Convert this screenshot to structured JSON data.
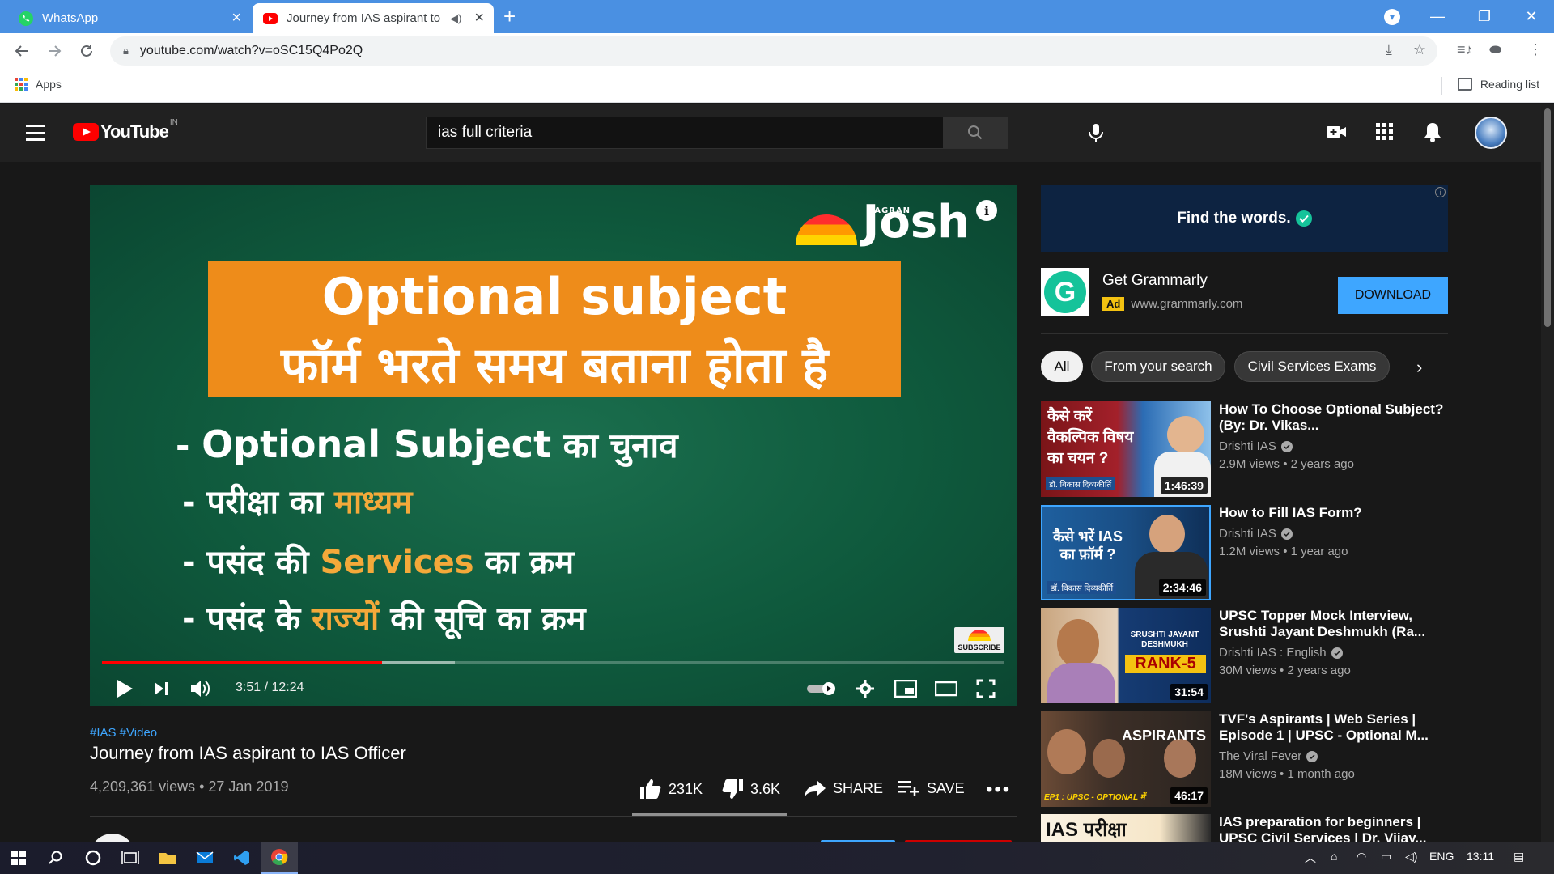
{
  "browser": {
    "tabs": [
      {
        "label": "WhatsApp",
        "icon": "whatsapp-icon",
        "active": false
      },
      {
        "label": "Journey from IAS aspirant to",
        "icon": "youtube-icon",
        "active": true
      }
    ],
    "url": "youtube.com/watch?v=oSC15Q4Po2Q",
    "bookmarks": {
      "apps_label": "Apps",
      "reading_list_label": "Reading list"
    }
  },
  "yt": {
    "logo_text": "YouTube",
    "region": "IN",
    "search_query": "ias full criteria"
  },
  "player": {
    "brand_small": "JAGRAN",
    "brand": "Josh",
    "banner_line1": "Optional subject",
    "banner_line2": "फॉर्म भरते समय बताना होता है",
    "bullets": [
      {
        "prefix": "- ",
        "highlight_white": "Optional Subject",
        "rest": " का चुनाव"
      },
      {
        "prefix": "- परीक्षा का ",
        "highlight": "माध्यम",
        "rest": ""
      },
      {
        "prefix": "- पसंद की ",
        "highlight": "Services",
        "rest": " का क्रम"
      },
      {
        "prefix": "- पसंद के ",
        "highlight": "राज्यों",
        "rest": " की सूचि का क्रम"
      }
    ],
    "subscribe_badge": "SUBSCRIBE",
    "time_text": "3:51 / 12:24",
    "progress_fraction": 0.3104,
    "buffer_fraction": 0.31
  },
  "video": {
    "tags": "#IAS #Video",
    "title": "Journey from IAS aspirant to IAS Officer",
    "views_date": "4,209,361 views • 27 Jan 2019",
    "likes": "231K",
    "dislikes": "3.6K",
    "share_label": "SHARE",
    "save_label": "SAVE"
  },
  "ad": {
    "banner_text": "Find the words.",
    "title": "Get Grammarly",
    "badge": "Ad",
    "domain": "www.grammarly.com",
    "cta": "DOWNLOAD"
  },
  "chips": [
    "All",
    "From your search",
    "Civil Services Exams"
  ],
  "recommendations": [
    {
      "title": "How To Choose Optional Subject? (By: Dr. Vikas...",
      "channel": "Drishti IAS",
      "verified": true,
      "meta": "2.9M views • 2 years ago",
      "duration": "1:46:39",
      "thumb_text": "कैसे करें वैकल्पिक विषय का चयन ?",
      "thumb_caption": "डॉ. विकास दिव्यकीर्ति"
    },
    {
      "title": "How to Fill IAS Form?",
      "channel": "Drishti IAS",
      "verified": true,
      "meta": "1.2M views • 1 year ago",
      "duration": "2:34:46",
      "thumb_text": "कैसे भरें IAS का फ़ॉर्म ?",
      "thumb_caption": "डॉ. विकास दिव्यकीर्ति"
    },
    {
      "title": "UPSC Topper Mock Interview, Srushti Jayant Deshmukh (Ra...",
      "channel": "Drishti IAS : English",
      "verified": true,
      "meta": "30M views • 2 years ago",
      "duration": "31:54",
      "thumb_text": "SRUSHTI JAYANT DESHMUKH",
      "thumb_caption": "RANK-5"
    },
    {
      "title": "TVF's Aspirants | Web Series | Episode 1 | UPSC - Optional M...",
      "channel": "The Viral Fever",
      "verified": true,
      "meta": "18M views • 1 month ago",
      "duration": "46:17",
      "thumb_text": "ASPIRANTS",
      "thumb_caption": "EP1 : UPSC - OPTIONAL में"
    },
    {
      "title": "IAS preparation for beginners | UPSC Civil Services | Dr. Vijay...",
      "channel": "",
      "verified": false,
      "meta": "",
      "duration": "",
      "thumb_text": "IAS परीक्षा",
      "thumb_caption": ""
    }
  ],
  "taskbar": {
    "lang": "ENG",
    "time": "13:11"
  },
  "colors": {
    "chrome_tabbar": "#4a90e2",
    "yt_red": "#ff0000",
    "yt_blue": "#3ea6ff",
    "player_green": "#0f5a3d",
    "banner_orange": "#ee8c1a"
  }
}
